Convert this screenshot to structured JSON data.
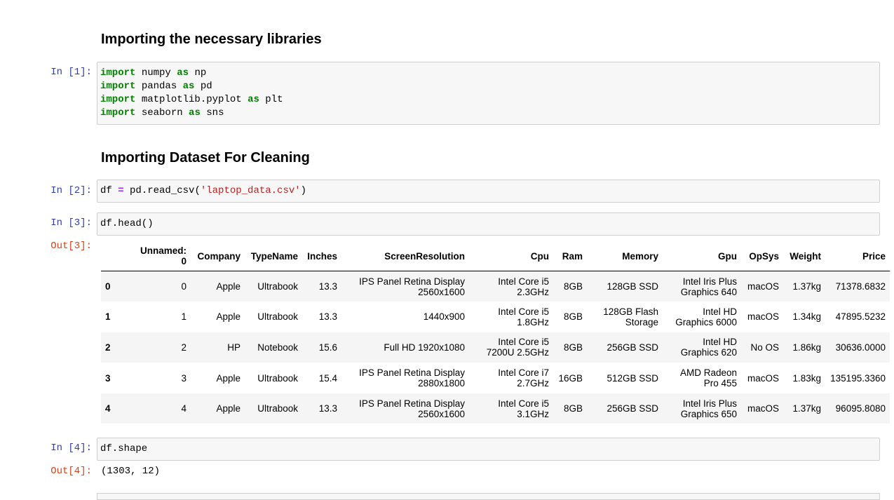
{
  "headings": {
    "h1": "Importing the necessary libraries",
    "h2": "Importing Dataset For Cleaning"
  },
  "cells": {
    "c1_prompt": "In [1]:",
    "c2_prompt": "In [2]:",
    "c3_prompt": "In [3]:",
    "c3_out_prompt": "Out[3]:",
    "c4_prompt": "In [4]:",
    "c4_out_prompt": "Out[4]:",
    "c4_output": "(1303, 12)"
  },
  "code": {
    "import_kw": "import",
    "as_kw": "as",
    "l1_mod": " numpy ",
    "l1_alias": " np",
    "l2_mod": " pandas ",
    "l2_alias": " pd",
    "l3_mod": " matplotlib.pyplot ",
    "l3_alias": " plt",
    "l4_mod": " seaborn ",
    "l4_alias": " sns",
    "c2_lhs": "df ",
    "c2_eq": "=",
    "c2_call": " pd.read_csv(",
    "c2_str": "'laptop_data.csv'",
    "c2_close": ")",
    "c3": "df.head()",
    "c4": "df.shape"
  },
  "table": {
    "columns": [
      "Unnamed:\n0",
      "Company",
      "TypeName",
      "Inches",
      "ScreenResolution",
      "Cpu",
      "Ram",
      "Memory",
      "Gpu",
      "OpSys",
      "Weight",
      "Price"
    ],
    "rows": [
      {
        "index": "0",
        "cells": [
          "0",
          "Apple",
          "Ultrabook",
          "13.3",
          "IPS Panel Retina Display 2560x1600",
          "Intel Core i5 2.3GHz",
          "8GB",
          "128GB SSD",
          "Intel Iris Plus Graphics 640",
          "macOS",
          "1.37kg",
          "71378.6832"
        ]
      },
      {
        "index": "1",
        "cells": [
          "1",
          "Apple",
          "Ultrabook",
          "13.3",
          "1440x900",
          "Intel Core i5 1.8GHz",
          "8GB",
          "128GB Flash Storage",
          "Intel HD Graphics 6000",
          "macOS",
          "1.34kg",
          "47895.5232"
        ]
      },
      {
        "index": "2",
        "cells": [
          "2",
          "HP",
          "Notebook",
          "15.6",
          "Full HD 1920x1080",
          "Intel Core i5 7200U 2.5GHz",
          "8GB",
          "256GB SSD",
          "Intel HD Graphics 620",
          "No OS",
          "1.86kg",
          "30636.0000"
        ]
      },
      {
        "index": "3",
        "cells": [
          "3",
          "Apple",
          "Ultrabook",
          "15.4",
          "IPS Panel Retina Display 2880x1800",
          "Intel Core i7 2.7GHz",
          "16GB",
          "512GB SSD",
          "AMD Radeon Pro 455",
          "macOS",
          "1.83kg",
          "135195.3360"
        ]
      },
      {
        "index": "4",
        "cells": [
          "4",
          "Apple",
          "Ultrabook",
          "13.3",
          "IPS Panel Retina Display 2560x1600",
          "Intel Core i5 3.1GHz",
          "8GB",
          "256GB SSD",
          "Intel Iris Plus Graphics 650",
          "macOS",
          "1.37kg",
          "96095.8080"
        ]
      }
    ]
  }
}
